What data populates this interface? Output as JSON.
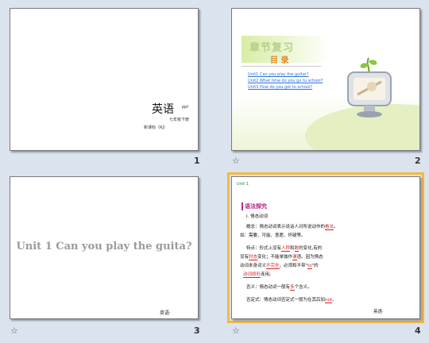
{
  "slides": [
    {
      "number": "1",
      "title": "英语",
      "subtitle": "ppt",
      "grade": "七年级下册",
      "publisher": "新课标（RJ）"
    },
    {
      "number": "2",
      "heading": "章节复习",
      "menu": "目 录",
      "links": [
        "Unit1  Can you play the guitar?",
        "Unit2  What time do you go to school?",
        "Unit3  How do you get to school?"
      ]
    },
    {
      "number": "3",
      "title": "Unit 1   Can you play the guita?",
      "footer": "英语·"
    },
    {
      "number": "4",
      "unit": "Unit 1",
      "box": "语法探究",
      "section": "Ⅰ. 情态动词",
      "lines": [
        {
          "a": "概念：情态动词表示说话人对所说动作的",
          "b": "看法",
          "c": "。"
        },
        {
          "a": "如：需要、可能、意愿、怀疑等。"
        },
        {
          "a": "特点：形式上没有",
          "b": "人称",
          "c": "和",
          "d": "数",
          "e": "的变化,有的"
        },
        {
          "a": "没有",
          "b": "时态",
          "c": "变化；不能单独作",
          "d": "谓",
          "e": "语。因为情态"
        },
        {
          "a": "动词本身词义",
          "b": "不完全",
          "c": "，必须和不带\"",
          "d": "to",
          "e": "\"的"
        },
        {
          "a": "",
          "b": "动词原形",
          "c": "连用。"
        },
        {
          "a": "否义：情态动词一般有",
          "b": "多",
          "c": "个含义。"
        },
        {
          "a": "否定式：情态动词否定式一般为在其后加",
          "b": "not",
          "c": "。"
        }
      ],
      "footer": "英语·"
    }
  ]
}
